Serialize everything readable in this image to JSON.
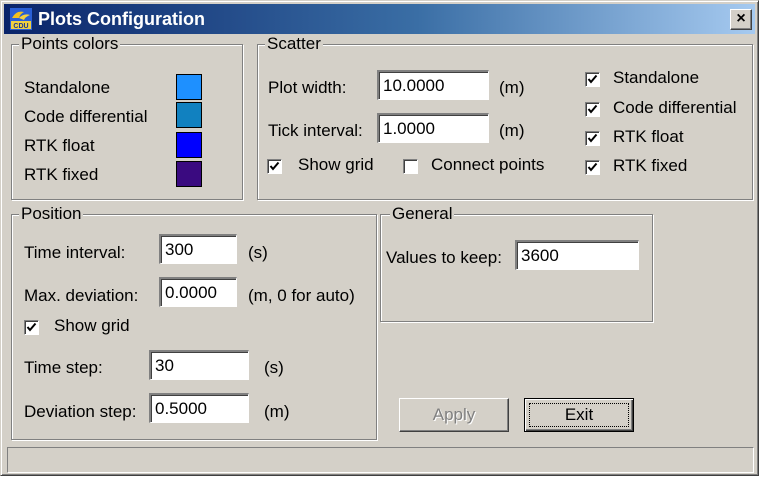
{
  "window": {
    "title": "Plots Configuration",
    "close_glyph": "×"
  },
  "points_colors": {
    "title": "Points colors",
    "items": [
      {
        "label": "Standalone",
        "color": "#1e90ff"
      },
      {
        "label": "Code differential",
        "color": "#1181c0"
      },
      {
        "label": "RTK float",
        "color": "#0000ff"
      },
      {
        "label": "RTK fixed",
        "color": "#3a0a80"
      }
    ]
  },
  "scatter": {
    "title": "Scatter",
    "plot_width_label": "Plot width:",
    "plot_width_value": "10.0000",
    "plot_width_unit": "(m)",
    "tick_interval_label": "Tick interval:",
    "tick_interval_value": "1.0000",
    "tick_interval_unit": "(m)",
    "show_grid_label": "Show grid",
    "show_grid_checked": true,
    "connect_points_label": "Connect points",
    "connect_points_checked": false,
    "series": [
      {
        "label": "Standalone",
        "checked": true
      },
      {
        "label": "Code differential",
        "checked": true
      },
      {
        "label": "RTK float",
        "checked": true
      },
      {
        "label": "RTK fixed",
        "checked": true
      }
    ]
  },
  "position": {
    "title": "Position",
    "time_interval_label": "Time interval:",
    "time_interval_value": "300",
    "time_interval_unit": "(s)",
    "max_deviation_label": "Max. deviation:",
    "max_deviation_value": "0.0000",
    "max_deviation_unit": "(m, 0 for auto)",
    "show_grid_label": "Show grid",
    "show_grid_checked": true,
    "time_step_label": "Time step:",
    "time_step_value": "30",
    "time_step_unit": "(s)",
    "deviation_step_label": "Deviation step:",
    "deviation_step_value": "0.5000",
    "deviation_step_unit": "(m)"
  },
  "general": {
    "title": "General",
    "values_to_keep_label": "Values to keep:",
    "values_to_keep_value": "3600"
  },
  "buttons": {
    "apply": "Apply",
    "exit": "Exit"
  },
  "status": {
    "text": ""
  }
}
